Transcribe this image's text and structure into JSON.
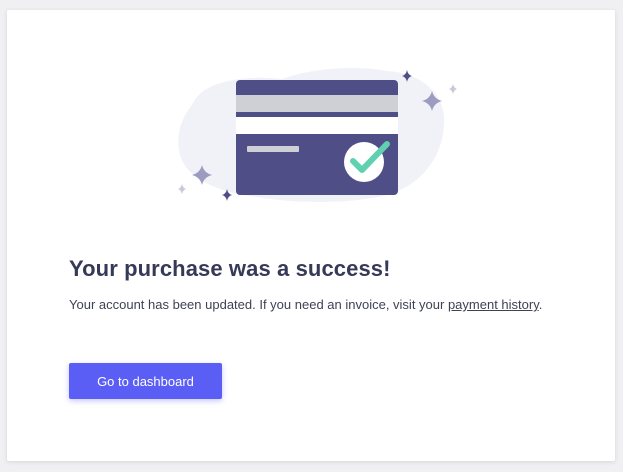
{
  "success": {
    "headline": "Your purchase was a success!",
    "message_prefix": "Your account has been updated. If you need an invoice, visit your ",
    "link_label": "payment history",
    "message_suffix": ".",
    "cta_label": "Go to dashboard"
  },
  "illustration": {
    "icon": "credit-card-checkmark-icon",
    "card_color": "#4f4e86",
    "check_color": "#5fd1b0",
    "blob_color": "#f1f1f8",
    "sparkle_color": "#9c9bc0"
  },
  "colors": {
    "primary": "#5b5ef5",
    "heading": "#363a57",
    "text": "#3f4254"
  }
}
